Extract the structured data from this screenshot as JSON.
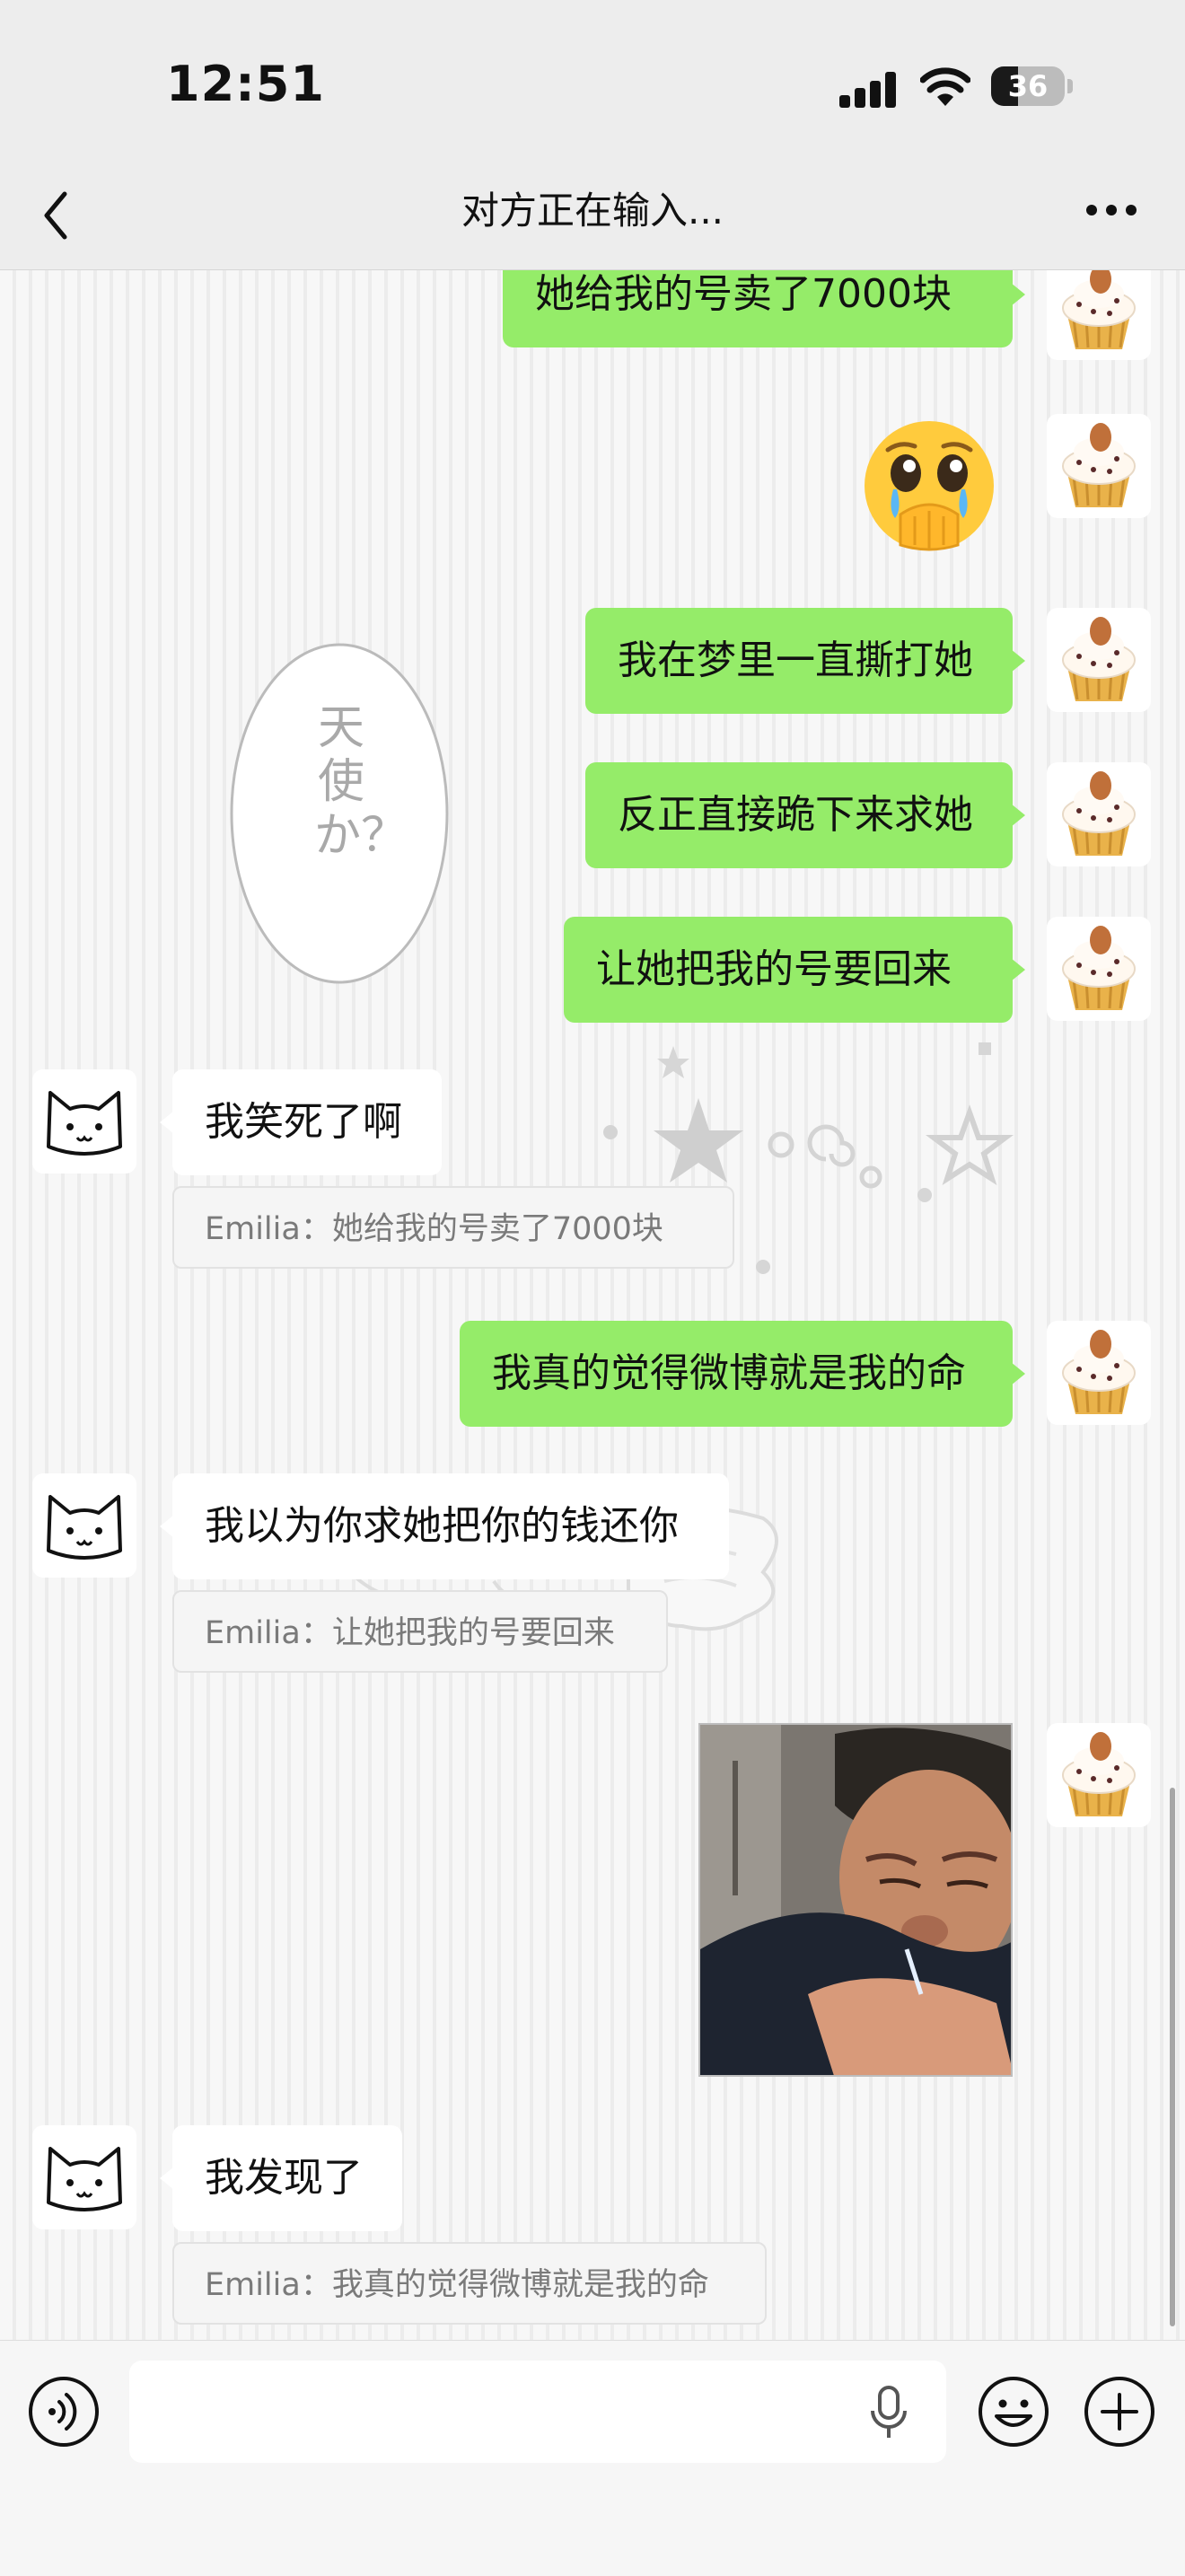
{
  "status_bar": {
    "time": "12:51",
    "battery": "36",
    "battery_level": 0.36
  },
  "nav": {
    "title": "对方正在输入..."
  },
  "decor": {
    "angel_text": "天使か？"
  },
  "messages": [
    {
      "side": "right",
      "type": "text",
      "text": "她给我的号卖了7000块",
      "avatar": "cupcake-avatar"
    },
    {
      "side": "right",
      "type": "emoji",
      "emoji": "🥹",
      "avatar": "cupcake-avatar"
    },
    {
      "side": "right",
      "type": "text",
      "text": "我在梦里一直撕打她",
      "avatar": "cupcake-avatar"
    },
    {
      "side": "right",
      "type": "text",
      "text": "反正直接跪下来求她",
      "avatar": "cupcake-avatar"
    },
    {
      "side": "right",
      "type": "text",
      "text": "让她把我的号要回来",
      "avatar": "cupcake-avatar"
    },
    {
      "side": "left",
      "type": "text",
      "text": "我笑死了啊",
      "quote": "Emilia：她给我的号卖了7000块",
      "avatar": "cat-avatar"
    },
    {
      "side": "right",
      "type": "text",
      "text": "我真的觉得微博就是我的命",
      "avatar": "cupcake-avatar"
    },
    {
      "side": "left",
      "type": "text",
      "text": "我以为你求她把你的钱还你",
      "quote": "Emilia：让她把我的号要回来",
      "avatar": "cat-avatar"
    },
    {
      "side": "right",
      "type": "image",
      "image": "crying-man-photo",
      "avatar": "cupcake-avatar"
    },
    {
      "side": "left",
      "type": "text",
      "text": "我发现了",
      "quote": "Emilia：我真的觉得微博就是我的命",
      "avatar": "cat-avatar"
    }
  ],
  "input_bar": {
    "placeholder": ""
  },
  "colors": {
    "my_bubble": "#95ec69",
    "their_bubble": "#ffffff",
    "background": "#ededed"
  }
}
